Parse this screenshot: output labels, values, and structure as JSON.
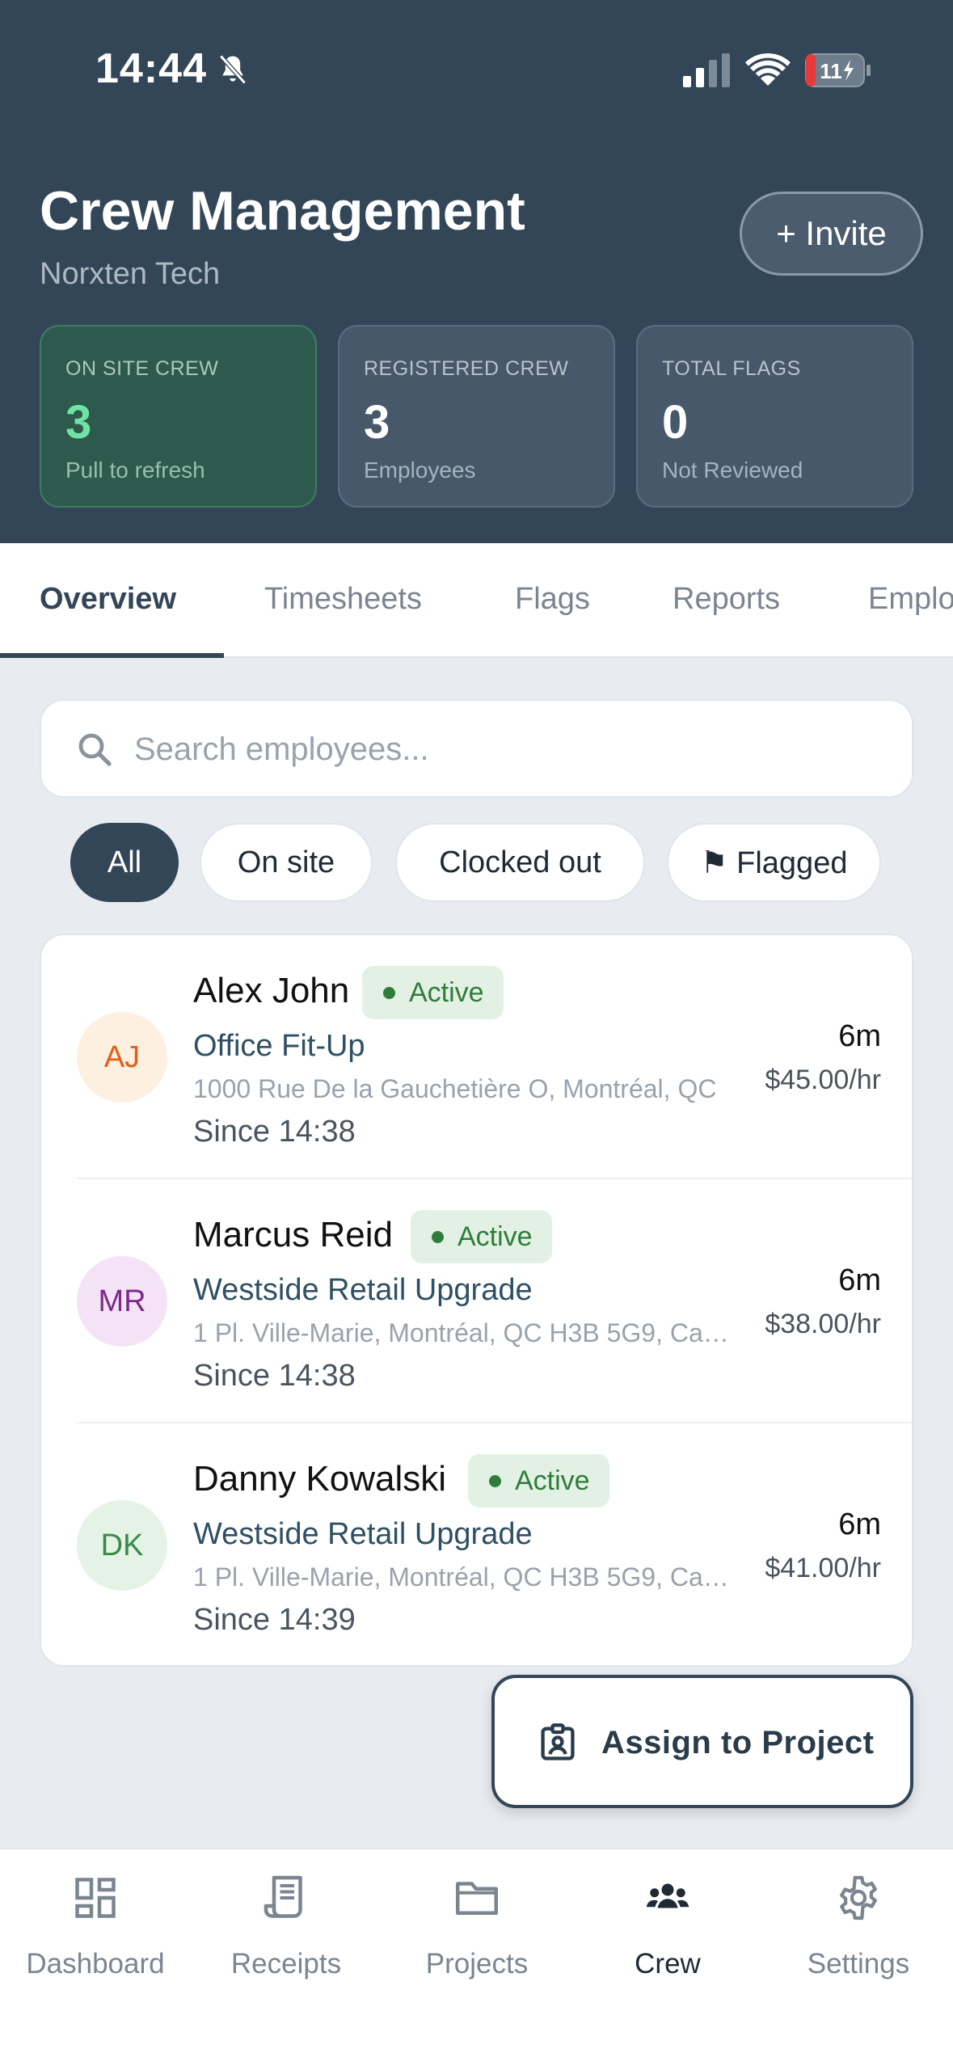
{
  "status_bar": {
    "time": "14:44",
    "battery": "11"
  },
  "header": {
    "title": "Crew Management",
    "subtitle": "Norxten Tech",
    "invite_label": "+ Invite"
  },
  "stats": [
    {
      "label": "ON SITE CREW",
      "value": "3",
      "caption": "Pull to refresh"
    },
    {
      "label": "REGISTERED CREW",
      "value": "3",
      "caption": "Employees"
    },
    {
      "label": "TOTAL FLAGS",
      "value": "0",
      "caption": "Not Reviewed"
    }
  ],
  "tabs": [
    {
      "label": "Overview"
    },
    {
      "label": "Timesheets"
    },
    {
      "label": "Flags"
    },
    {
      "label": "Reports"
    },
    {
      "label": "Emplo"
    }
  ],
  "search": {
    "placeholder": "Search employees..."
  },
  "filters": [
    {
      "label": "All"
    },
    {
      "label": "On site"
    },
    {
      "label": "Clocked out"
    },
    {
      "label": "⚑ Flagged"
    }
  ],
  "employees": [
    {
      "initials": "AJ",
      "name": "Alex John",
      "status": "Active",
      "project": "Office Fit-Up",
      "address": "1000 Rue De la Gauchetière O, Montréal, QC",
      "since": "Since 14:38",
      "duration": "6m",
      "rate": "$45.00/hr",
      "avatar_bg": "#fdf0e1",
      "avatar_fg": "#e0601a"
    },
    {
      "initials": "MR",
      "name": "Marcus Reid",
      "status": "Active",
      "project": "Westside Retail Upgrade",
      "address": "1 Pl. Ville-Marie, Montréal, QC H3B 5G9, Canada",
      "since": "Since 14:38",
      "duration": "6m",
      "rate": "$38.00/hr",
      "avatar_bg": "#f4e3f5",
      "avatar_fg": "#7b2a8c"
    },
    {
      "initials": "DK",
      "name": "Danny Kowalski",
      "status": "Active",
      "project": "Westside Retail Upgrade",
      "address": "1 Pl. Ville-Marie, Montréal, QC H3B 5G9, Canada",
      "since": "Since 14:39",
      "duration": "6m",
      "rate": "$41.00/hr",
      "avatar_bg": "#e4f3e6",
      "avatar_fg": "#3a8a47"
    }
  ],
  "assign_button": {
    "label": "Assign to Project"
  },
  "nav": [
    {
      "label": "Dashboard",
      "icon": "dashboard-icon"
    },
    {
      "label": "Receipts",
      "icon": "receipt-icon"
    },
    {
      "label": "Projects",
      "icon": "folder-icon"
    },
    {
      "label": "Crew",
      "icon": "crew-icon"
    },
    {
      "label": "Settings",
      "icon": "gear-icon"
    }
  ],
  "colors": {
    "header_bg": "#334657",
    "accent_green": "#6ee3a4",
    "active_badge": "#2e7d3a"
  }
}
